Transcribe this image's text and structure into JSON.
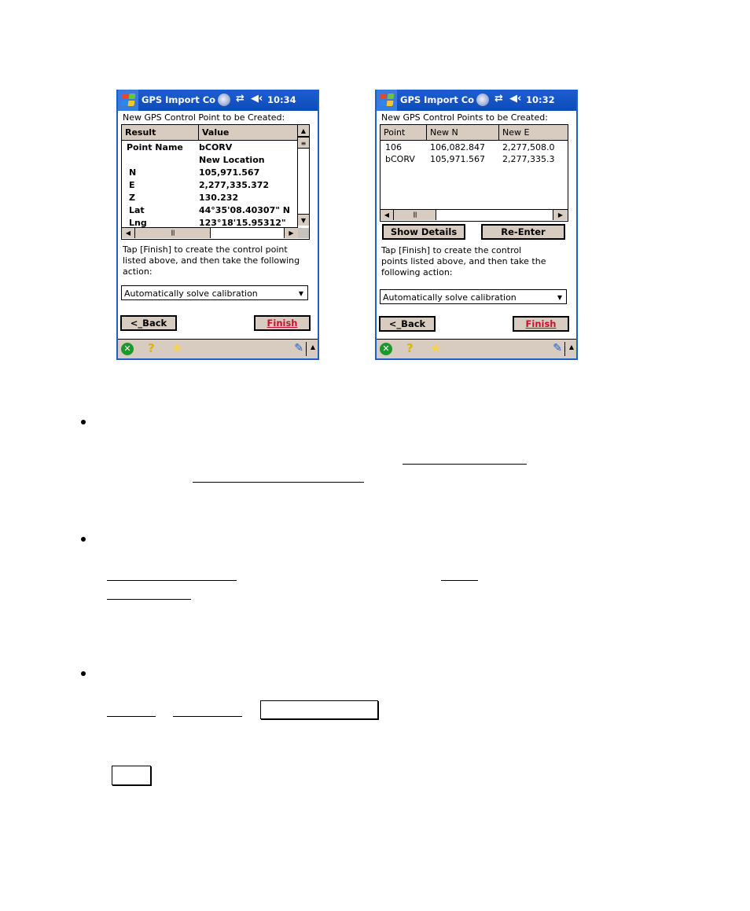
{
  "screens": [
    {
      "title": "GPS Import Co",
      "time": "10:34",
      "heading": "New GPS Control Point to be Created:",
      "columns": [
        "Result",
        "Value"
      ],
      "rows": [
        {
          "result": "Point Name",
          "value": "bCORV"
        },
        {
          "result": "",
          "value": "New Location"
        },
        {
          "result": "N",
          "value": "105,971.567"
        },
        {
          "result": "E",
          "value": "2,277,335.372"
        },
        {
          "result": "Z",
          "value": "130.232"
        },
        {
          "result": "Lat",
          "value": "44°35'08.40307\" N"
        },
        {
          "result": "Lng",
          "value": "123°18'15.95312\""
        }
      ],
      "instructions": "Tap [Finish] to create the control point listed above, and then take the following action:",
      "action_selected": "Automatically solve calibration",
      "back_label": "<_Back",
      "finish_label": "Finish"
    },
    {
      "title": "GPS Import Co",
      "time": "10:32",
      "heading": "New GPS Control Points to be Created:",
      "columns": [
        "Point",
        "New N",
        "New E"
      ],
      "rows": [
        {
          "point": "106",
          "n": "106,082.847",
          "e": "2,277,508.0"
        },
        {
          "point": "bCORV",
          "n": "105,971.567",
          "e": "2,277,335.3"
        }
      ],
      "show_details_label": "Show Details",
      "reenter_label": "Re-Enter",
      "instructions": "Tap [Finish] to create the control points listed above, and then take the following action:",
      "action_selected": "Automatically solve calibration",
      "back_label": "<_Back",
      "finish_label": "Finish"
    }
  ],
  "icons": {
    "start": "windows-flag-icon",
    "connectivity": "connectivity-icon",
    "sync": "sync-arrows-icon",
    "volume": "volume-icon",
    "close": "close-circle-icon",
    "help": "help-icon",
    "favorites": "star-icon",
    "input": "pen-icon",
    "sip": "arrow-up-icon"
  }
}
